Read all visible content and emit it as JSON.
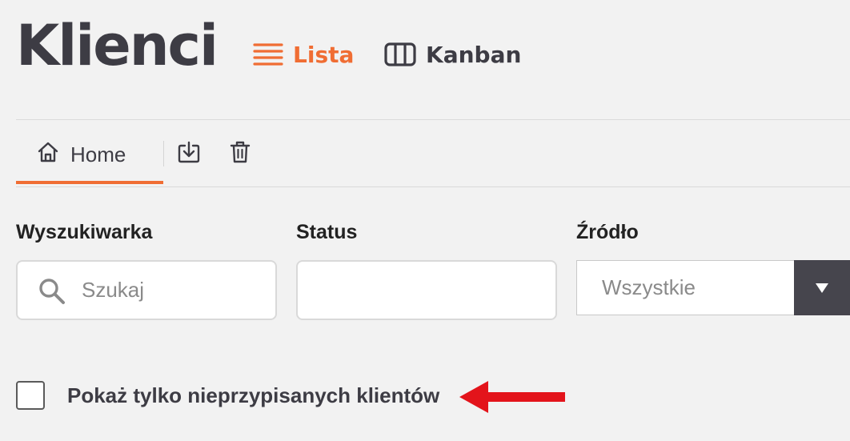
{
  "header": {
    "title": "Klienci",
    "views": [
      {
        "label": "Lista",
        "icon": "list-icon",
        "active": true
      },
      {
        "label": "Kanban",
        "icon": "kanban-columns-icon",
        "active": false
      }
    ]
  },
  "tabs": {
    "home_label": "Home",
    "home_icon": "home-icon",
    "tools": [
      {
        "icon": "export-icon"
      },
      {
        "icon": "trash-icon"
      }
    ]
  },
  "filters": {
    "search": {
      "label": "Wyszukiwarka",
      "placeholder": "Szukaj",
      "value": "",
      "icon": "search-icon"
    },
    "status": {
      "label": "Status",
      "value": ""
    },
    "source": {
      "label": "Źródło",
      "selected": "Wszystkie",
      "icon": "triangle-down-icon"
    }
  },
  "unassigned_filter": {
    "label": "Pokaż tylko nieprzypisanych klientów",
    "checked": false
  },
  "annotation": {
    "icon": "red-arrow-icon",
    "color": "#e3141b"
  },
  "colors": {
    "accent": "#f06d33",
    "text": "#3d3c44",
    "background": "#f2f2f2",
    "select_arrow_bg": "#46454d"
  }
}
